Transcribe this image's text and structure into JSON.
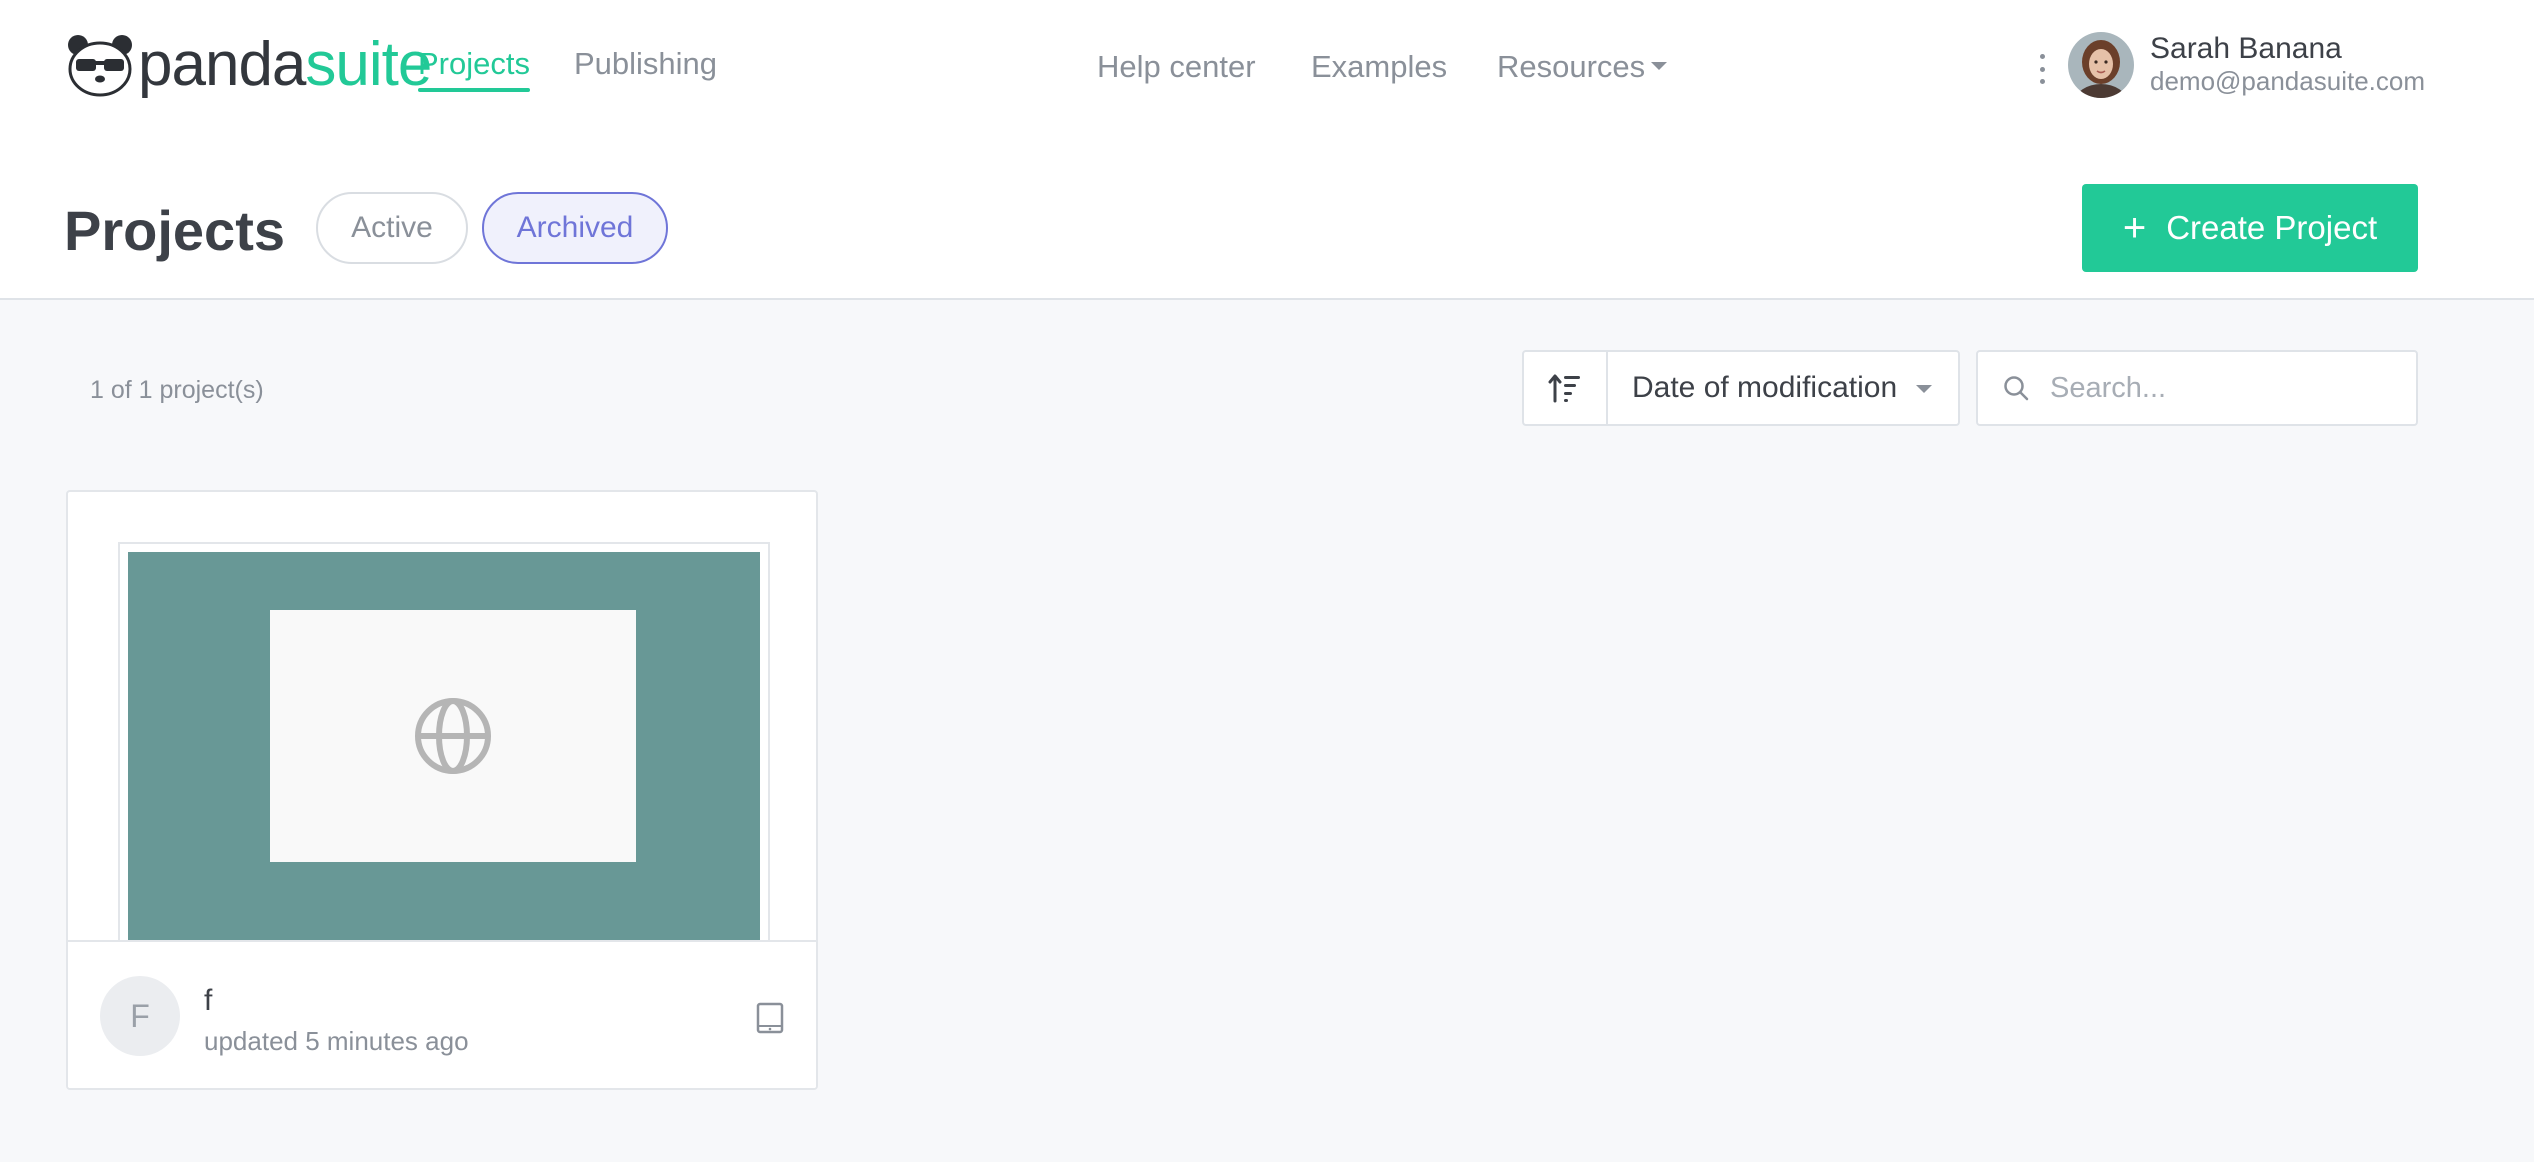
{
  "brand": {
    "name_a": "panda",
    "name_b": "suite"
  },
  "nav": {
    "projects": "Projects",
    "publishing": "Publishing"
  },
  "center_nav": {
    "help": "Help center",
    "examples": "Examples",
    "resources": "Resources"
  },
  "user": {
    "name": "Sarah Banana",
    "email": "demo@pandasuite.com"
  },
  "page": {
    "title": "Projects"
  },
  "filters": {
    "active": "Active",
    "archived": "Archived"
  },
  "create": {
    "label": "Create Project"
  },
  "list": {
    "count": "1 of 1 project(s)"
  },
  "sort": {
    "selected": "Date of modification"
  },
  "search": {
    "placeholder": "Search..."
  },
  "projects": [
    {
      "initial": "F",
      "name": "f",
      "updated": "updated 5 minutes ago"
    }
  ],
  "colors": {
    "accent": "#22c997",
    "archived": "#6f75d8",
    "thumbnail": "#689896"
  }
}
